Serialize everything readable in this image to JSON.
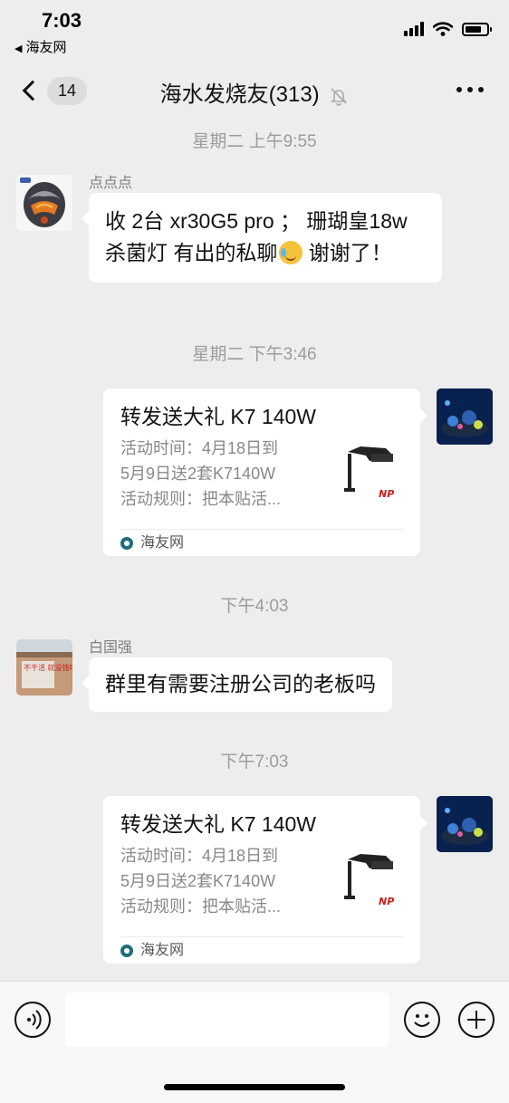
{
  "status_bar": {
    "time": "7:03",
    "back_app": "海友网"
  },
  "nav": {
    "unread_count": "14",
    "title": "海水发烧友(313)"
  },
  "messages": [
    {
      "type": "time",
      "text": "星期二 上午9:55"
    },
    {
      "type": "text",
      "side": "left",
      "sender": "点点点",
      "text_before_emoji": "收 2台 xr30G5 pro ； 珊瑚皇18w杀菌灯 有出的私聊",
      "emoji": "crying-laughing-emoji",
      "text_after_emoji": " 谢谢了！"
    },
    {
      "type": "time",
      "text": "星期二 下午3:46"
    },
    {
      "type": "link",
      "side": "right",
      "title": "转发送大礼 K7 140W",
      "desc_lines": [
        "活动时间：4月18日到",
        "5月9日送2套K7140W",
        "活动规则：把本贴活..."
      ],
      "source": "海友网"
    },
    {
      "type": "time",
      "text": "下午4:03"
    },
    {
      "type": "text",
      "side": "left",
      "sender": "白国强",
      "text": "群里有需要注册公司的老板吗"
    },
    {
      "type": "time",
      "text": "下午7:03"
    },
    {
      "type": "link",
      "side": "right",
      "title": "转发送大礼 K7 140W",
      "desc_lines": [
        "活动时间：4月18日到",
        "5月9日送2套K7140W",
        "活动规则：把本贴活..."
      ],
      "source": "海友网"
    }
  ],
  "avatars": {
    "user1_banner_text": "不干活 就没钱吃"
  },
  "card_logo_text": "NP",
  "input": {
    "placeholder": ""
  },
  "colors": {
    "background": "#ededed",
    "bubble": "#ffffff",
    "timestamp": "#9c9c9c"
  }
}
